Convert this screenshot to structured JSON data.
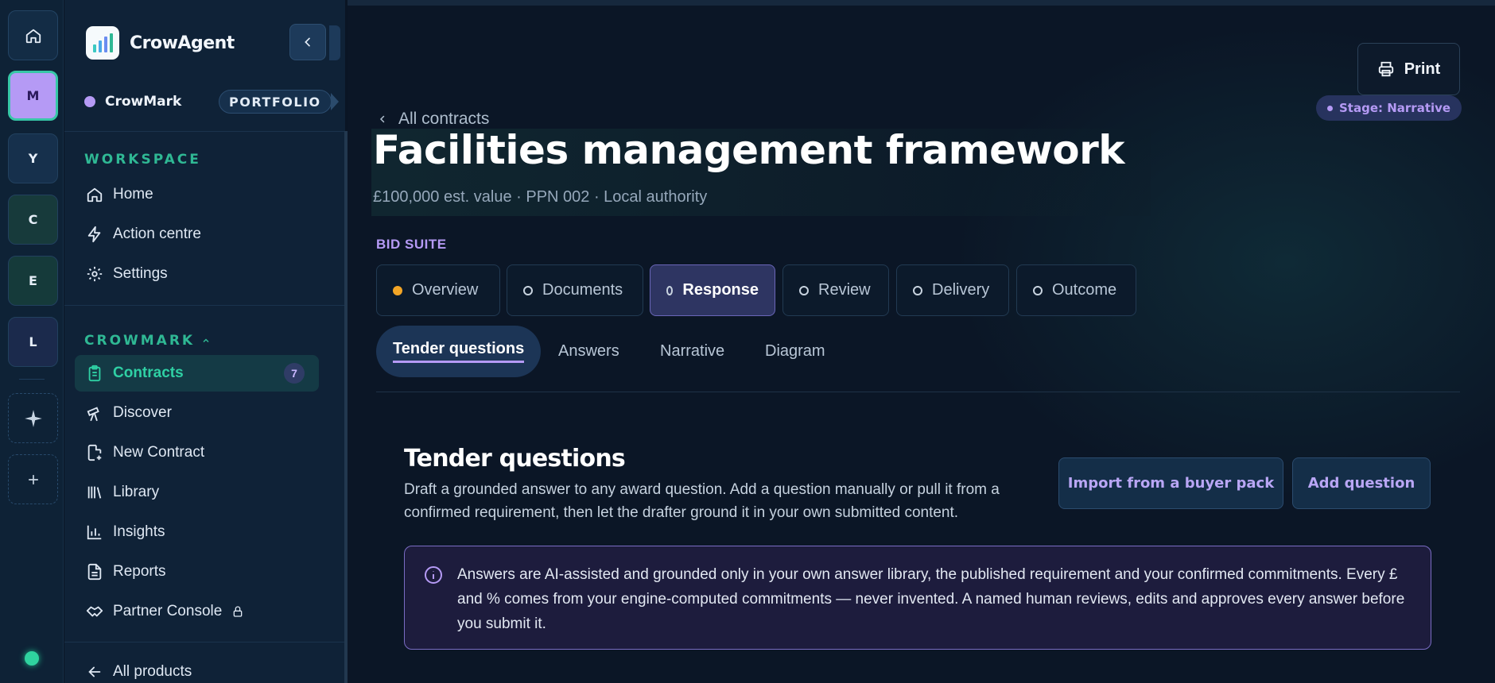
{
  "rail": {
    "workspaces": [
      {
        "letter": "M",
        "active": true
      },
      {
        "letter": "Y",
        "active": false
      },
      {
        "letter": "C",
        "active": false
      },
      {
        "letter": "E",
        "active": false
      },
      {
        "letter": "L",
        "active": false
      }
    ]
  },
  "sidebar": {
    "brand": "CrowAgent",
    "org": "CrowMark",
    "org_badge": "PORTFOLIO",
    "workspace_label": "WORKSPACE",
    "workspace_items": [
      {
        "label": "Home",
        "icon": "home-icon"
      },
      {
        "label": "Action centre",
        "icon": "bolt-icon"
      },
      {
        "label": "Settings",
        "icon": "gear-icon"
      }
    ],
    "crowmark_label": "CROWMARK",
    "crowmark_items": [
      {
        "label": "Contracts",
        "icon": "clipboard-icon",
        "active": true,
        "badge": "7"
      },
      {
        "label": "Discover",
        "icon": "telescope-icon"
      },
      {
        "label": "New Contract",
        "icon": "file-plus-icon"
      },
      {
        "label": "Library",
        "icon": "library-icon"
      },
      {
        "label": "Insights",
        "icon": "bar-chart-icon"
      },
      {
        "label": "Reports",
        "icon": "document-icon"
      },
      {
        "label": "Partner Console",
        "icon": "handshake-icon"
      }
    ],
    "all_products": "All products"
  },
  "main": {
    "print_label": "Print",
    "stage_badge": "Stage: Narrative",
    "back_link": "All contracts",
    "title": "Facilities management framework",
    "subtitle": "£100,000 est. value · PPN 002 · Local authority",
    "suite_label": "BID SUITE",
    "stage_tabs": [
      {
        "label": "Overview",
        "status": "in-progress"
      },
      {
        "label": "Documents",
        "status": "pending"
      },
      {
        "label": "Response",
        "status": "pending",
        "active": true
      },
      {
        "label": "Review",
        "status": "pending"
      },
      {
        "label": "Delivery",
        "status": "pending"
      },
      {
        "label": "Outcome",
        "status": "pending"
      }
    ],
    "sub_tabs": [
      {
        "label": "Tender questions",
        "active": true
      },
      {
        "label": "Answers"
      },
      {
        "label": "Narrative"
      },
      {
        "label": "Diagram"
      }
    ],
    "section": {
      "title": "Tender questions",
      "description": "Draft a grounded answer to any award question. Add a question manually or pull it from a confirmed requirement, then let the drafter ground it in your own submitted content.",
      "import_button": "Import from a buyer pack",
      "add_button": "Add question",
      "notice": "Answers are AI-assisted and grounded only in your own answer library, the published requirement and your confirmed commitments. Every £ and % comes from your engine-computed commitments — never invented. A named human reviews, edits and approves every answer before you submit it."
    }
  },
  "colors": {
    "accent_teal": "#2fb894",
    "accent_purple": "#b59af5",
    "status_orange": "#f3a526"
  }
}
